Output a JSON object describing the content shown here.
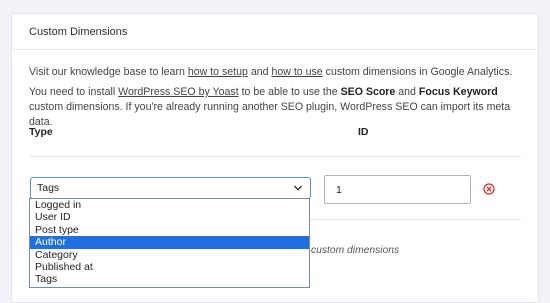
{
  "panel": {
    "title": "Custom Dimensions",
    "intro": {
      "before": "Visit our knowledge base to learn ",
      "link1": "how to setup",
      "mid": " and ",
      "link2": "how to use",
      "after": " custom dimensions in Google Analytics."
    },
    "notice": {
      "before": "You need to install ",
      "link": "WordPress SEO by Yoast",
      "mid1": " to be able to use the ",
      "bold1": "SEO Score",
      "mid2": " and ",
      "bold2": "Focus Keyword",
      "after": " custom dimensions. If you're already running another SEO plugin, WordPress SEO can import its meta data."
    }
  },
  "columns": {
    "type": "Type",
    "id": "ID"
  },
  "row": {
    "selected_type": "Tags",
    "id_value": "1"
  },
  "dropdown": {
    "options": [
      "Logged in",
      "User ID",
      "Post type",
      "Author",
      "Category",
      "Published at",
      "Tags"
    ],
    "highlighted": "Author"
  },
  "obscured_text": "custom dimensions",
  "colors": {
    "accent": "#1e6fe0",
    "remove": "#d9312b",
    "background": "#f1f3f9"
  },
  "icons": {
    "select": "chevron-down-icon",
    "remove": "remove-circle-icon"
  }
}
